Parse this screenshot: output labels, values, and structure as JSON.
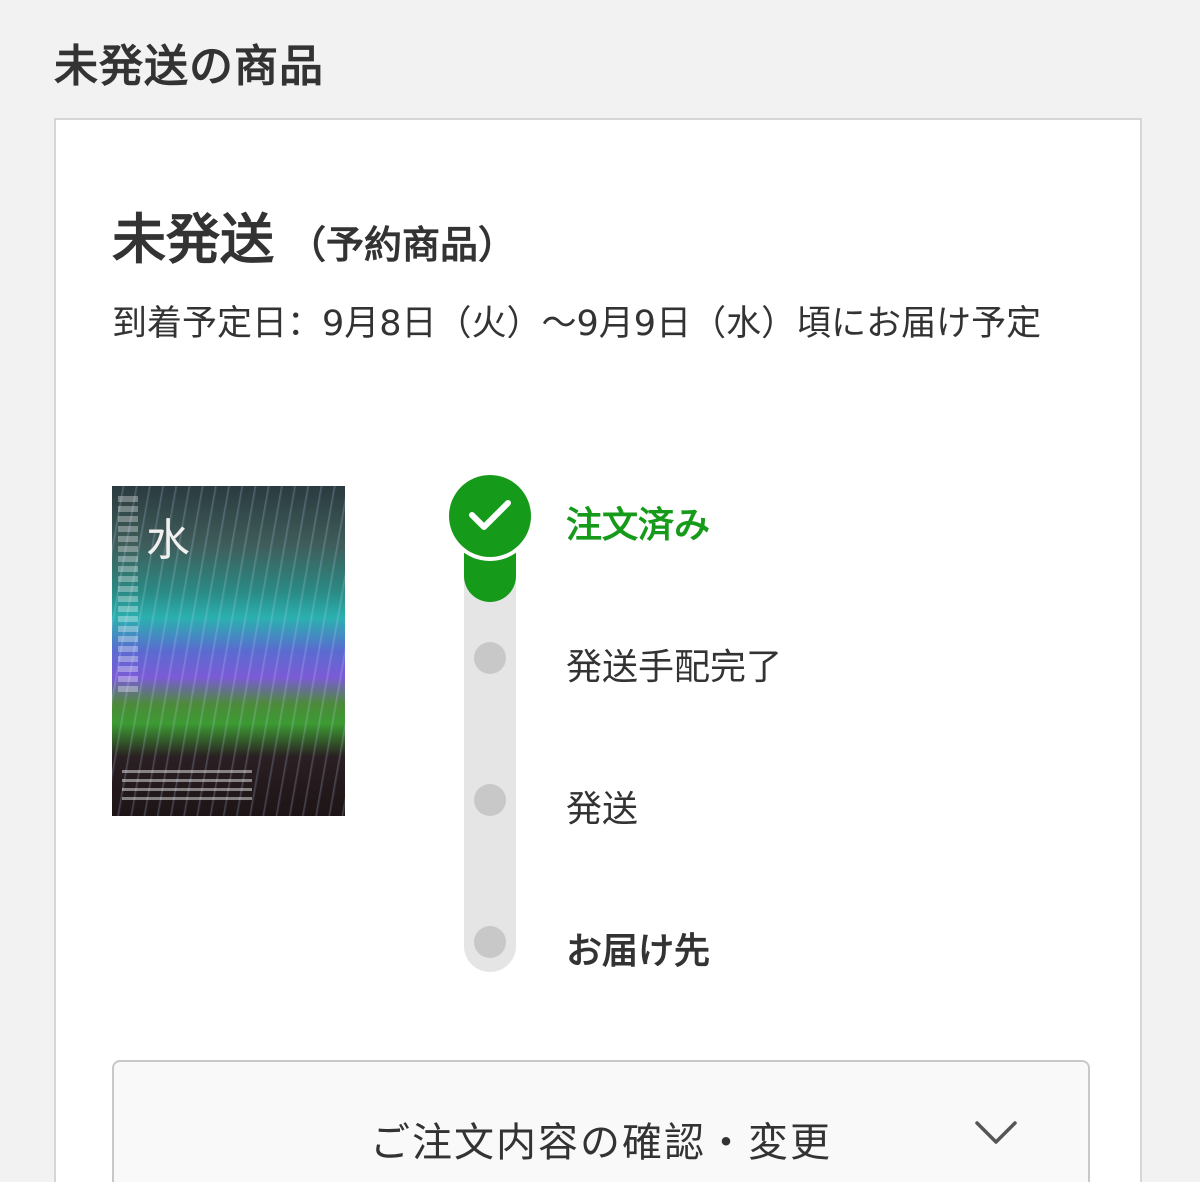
{
  "section_title": "未発送の商品",
  "card": {
    "status": "未発送",
    "status_note": "（予約商品）",
    "arrival_text": "到着予定日：9月8日（火）〜9月9日（水）頃にお届け予定",
    "product_image": {
      "icon": "product-cover-image",
      "cover_text": "水"
    },
    "progress": {
      "steps": [
        {
          "label": "注文済み",
          "state": "done"
        },
        {
          "label": "発送手配完了",
          "state": "pending"
        },
        {
          "label": "発送",
          "state": "pending"
        },
        {
          "label": "お届け先",
          "state": "pending"
        }
      ],
      "completed_steps": 1
    },
    "confirm_button": {
      "label": "ご注文内容の確認・変更",
      "icon": "chevron-down-icon"
    }
  },
  "colors": {
    "accent_green": "#159a1a",
    "track_gray": "#e5e5e5",
    "dot_gray": "#c8c8c8",
    "text": "#333333",
    "page_background": "#f2f2f2"
  }
}
